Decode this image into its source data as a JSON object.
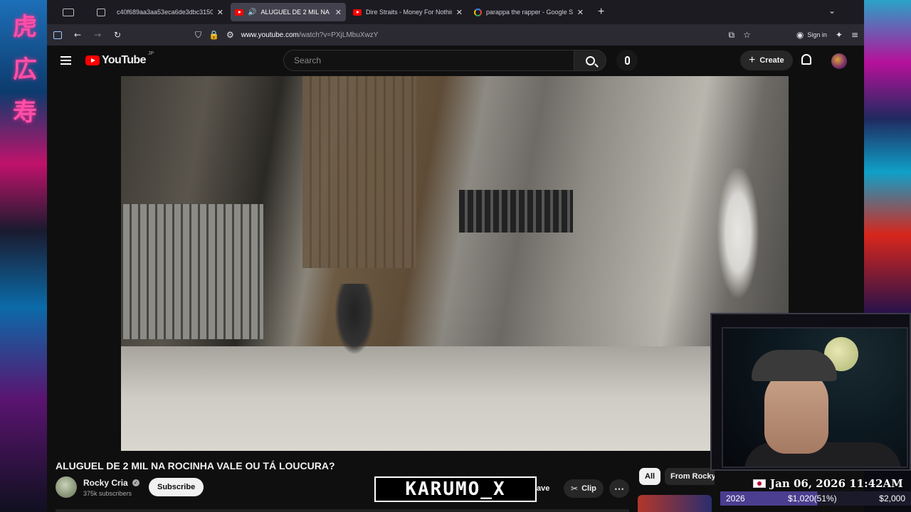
{
  "browser": {
    "tabs": [
      {
        "title": "c40f689aa3aa53eca6de3dbc3150",
        "favicon": "document-icon",
        "active": false
      },
      {
        "title": "ALUGUEL DE 2 MIL NA RO",
        "favicon": "youtube-icon",
        "active": true,
        "audio": true
      },
      {
        "title": "Dire Straits - Money For Nothin",
        "favicon": "youtube-icon",
        "active": false
      },
      {
        "title": "parappa the rapper - Google Se",
        "favicon": "google-icon",
        "active": false
      }
    ],
    "url_host": "www.youtube.com",
    "url_path": "/watch?v=PXjLMbuXwzY",
    "sign_in_label": "Sign in"
  },
  "youtube": {
    "logo_text": "YouTube",
    "country_code": "JP",
    "search_placeholder": "Search",
    "create_label": "Create",
    "video_title": "ALUGUEL DE 2 MIL NA ROCINHA VALE OU TÁ LOUCURA?",
    "channel_name": "Rocky Cria",
    "subscribers": "375k subscribers",
    "subscribe_label": "Subscribe",
    "save_label": "ave",
    "clip_label": "Clip",
    "more_label": "⋯",
    "chips": {
      "all": "All",
      "from": "From Rocky"
    }
  },
  "overlay": {
    "watermark": "KARUMO_X",
    "datetime": "Jan 06, 2026 11:42AM",
    "goal_year": "2026",
    "goal_amount": "$1,020(51%)",
    "goal_target": "$2,000",
    "goal_progress": 0.51,
    "colors": {
      "goal_fill": "#4b3d8f",
      "accent_red": "#ff0000"
    }
  }
}
